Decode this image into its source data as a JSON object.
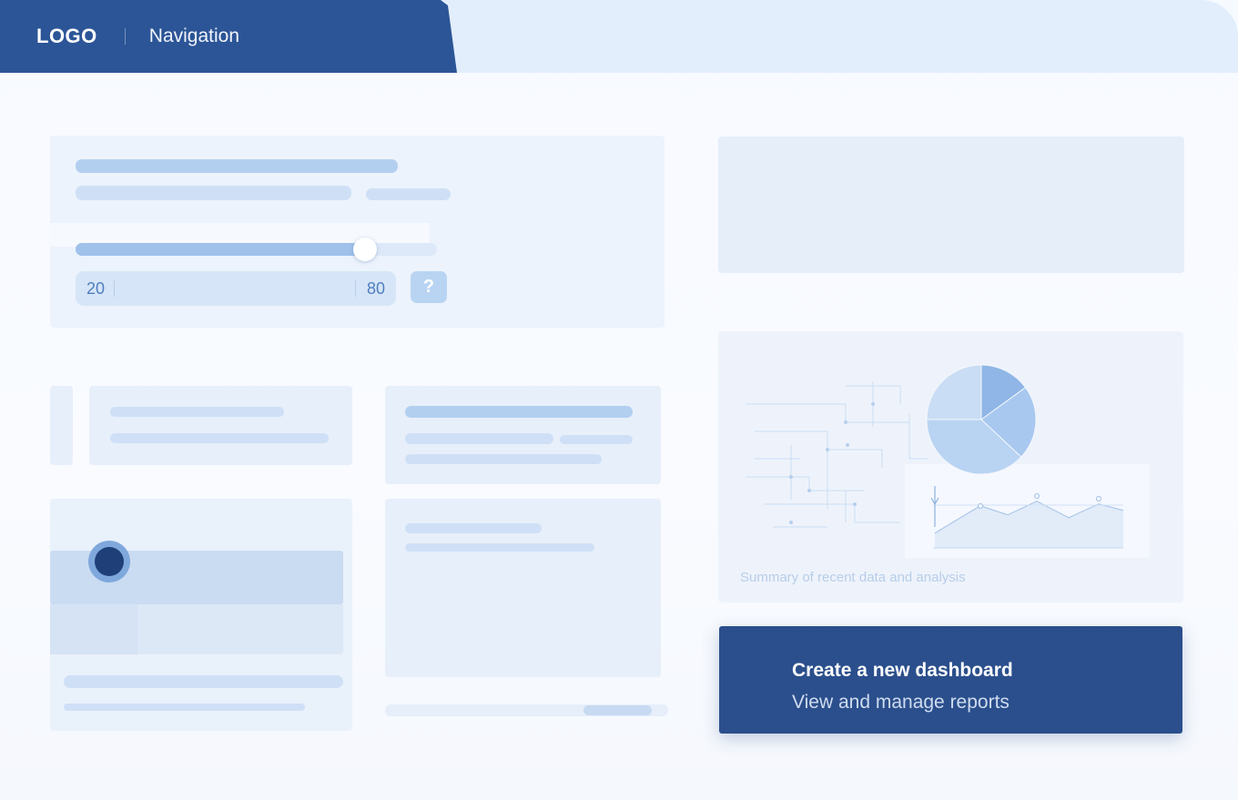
{
  "header": {
    "logo": "LOGO",
    "nav_label": "Navigation"
  },
  "filter": {
    "range_min": "20",
    "range_max": "80",
    "slider_fraction": 0.8,
    "help_label": "?"
  },
  "analytics": {
    "caption": "Summary of recent data and analysis",
    "pie_slices": [
      0.15,
      0.22,
      0.38,
      0.25
    ]
  },
  "cta": {
    "title": "Create a new dashboard",
    "subtitle": "View and manage reports"
  },
  "colors": {
    "brand": "#2c5597",
    "cta": "#2b4f8c",
    "accent_light": "#b3cff0"
  },
  "icons": {
    "help": "question-mark-icon",
    "selected_radio": "radio-selected-icon"
  }
}
